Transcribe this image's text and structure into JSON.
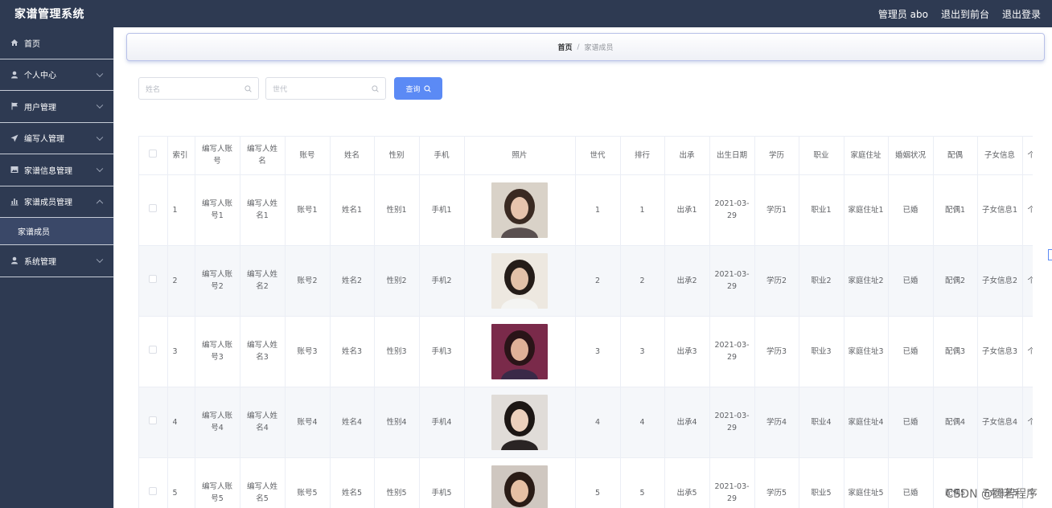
{
  "app": {
    "title": "家谱管理系统",
    "admin_label": "管理员 abo",
    "front_link": "退出到前台",
    "logout_link": "退出登录"
  },
  "sidebar": {
    "items": [
      {
        "label": "首页",
        "icon": "home-icon"
      },
      {
        "label": "个人中心",
        "icon": "user-icon"
      },
      {
        "label": "用户管理",
        "icon": "flag-icon"
      },
      {
        "label": "编写人管理",
        "icon": "send-icon"
      },
      {
        "label": "家谱信息管理",
        "icon": "picture-icon"
      },
      {
        "label": "家谱成员管理",
        "icon": "chart-icon"
      },
      {
        "label": "系统管理",
        "icon": "user-icon"
      }
    ],
    "active_sub": "家谱成员"
  },
  "breadcrumb": {
    "home": "首页",
    "separator": "/",
    "current": "家谱成员"
  },
  "search": {
    "name_placeholder": "姓名",
    "generation_placeholder": "世代",
    "query_label": "查询"
  },
  "table": {
    "columns": [
      "索引",
      "编写人账号",
      "编写人姓名",
      "账号",
      "姓名",
      "性别",
      "手机",
      "照片",
      "世代",
      "排行",
      "出承",
      "出生日期",
      "学历",
      "职业",
      "家庭住址",
      "婚姻状况",
      "配偶",
      "子女信息",
      "个"
    ],
    "rows": [
      {
        "index": "1",
        "writer_account": "编写人账号1",
        "writer_name": "编写人姓名1",
        "account": "账号1",
        "name": "姓名1",
        "gender": "性别1",
        "phone": "手机1",
        "generation": "1",
        "rank": "1",
        "origin": "出承1",
        "birth": "2021-03-29",
        "education": "学历1",
        "job": "职业1",
        "address": "家庭住址1",
        "marital": "已婚",
        "spouse": "配偶1",
        "children": "子女信息1",
        "more": "个"
      },
      {
        "index": "2",
        "writer_account": "编写人账号2",
        "writer_name": "编写人姓名2",
        "account": "账号2",
        "name": "姓名2",
        "gender": "性别2",
        "phone": "手机2",
        "generation": "2",
        "rank": "2",
        "origin": "出承2",
        "birth": "2021-03-29",
        "education": "学历2",
        "job": "职业2",
        "address": "家庭住址2",
        "marital": "已婚",
        "spouse": "配偶2",
        "children": "子女信息2",
        "more": "个"
      },
      {
        "index": "3",
        "writer_account": "编写人账号3",
        "writer_name": "编写人姓名3",
        "account": "账号3",
        "name": "姓名3",
        "gender": "性别3",
        "phone": "手机3",
        "generation": "3",
        "rank": "3",
        "origin": "出承3",
        "birth": "2021-03-29",
        "education": "学历3",
        "job": "职业3",
        "address": "家庭住址3",
        "marital": "已婚",
        "spouse": "配偶3",
        "children": "子女信息3",
        "more": "个"
      },
      {
        "index": "4",
        "writer_account": "编写人账号4",
        "writer_name": "编写人姓名4",
        "account": "账号4",
        "name": "姓名4",
        "gender": "性别4",
        "phone": "手机4",
        "generation": "4",
        "rank": "4",
        "origin": "出承4",
        "birth": "2021-03-29",
        "education": "学历4",
        "job": "职业4",
        "address": "家庭住址4",
        "marital": "已婚",
        "spouse": "配偶4",
        "children": "子女信息4",
        "more": "个"
      },
      {
        "index": "5",
        "writer_account": "编写人账号5",
        "writer_name": "编写人姓名5",
        "account": "账号5",
        "name": "姓名5",
        "gender": "性别5",
        "phone": "手机5",
        "generation": "5",
        "rank": "5",
        "origin": "出承5",
        "birth": "2021-03-29",
        "education": "学历5",
        "job": "职业5",
        "address": "家庭住址5",
        "marital": "已婚",
        "spouse": "配偶5",
        "children": "子女信息5",
        "more": "个"
      }
    ]
  },
  "watermark": "CSDN @圆若程序",
  "colors": {
    "sidebar_bg": "#2e3a52",
    "primary": "#5b8af5",
    "stripe": "#f5f7fa"
  }
}
